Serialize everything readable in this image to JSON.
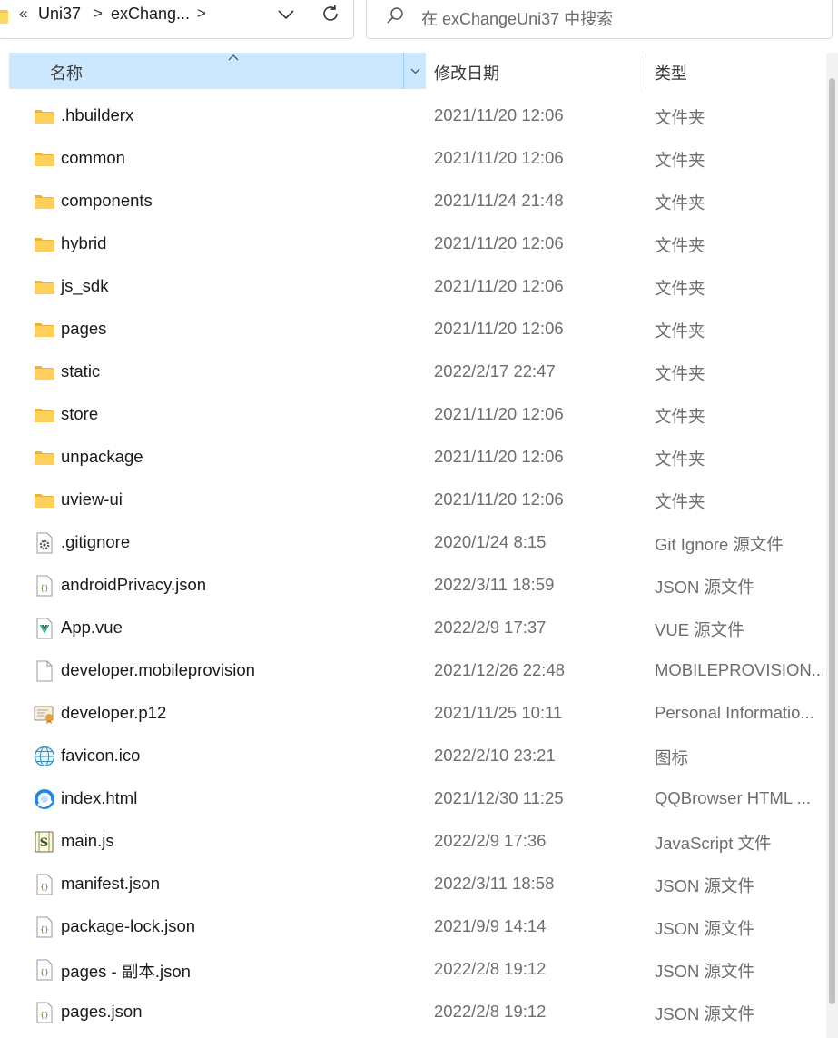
{
  "address_bar": {
    "overflow_glyph": "«",
    "crumbs": [
      "Uni37",
      "exChang..."
    ],
    "separator": ">"
  },
  "search": {
    "placeholder": "在 exChangeUni37 中搜索"
  },
  "columns": {
    "name": "名称",
    "date": "修改日期",
    "type": "类型"
  },
  "files": [
    {
      "name": ".hbuilderx",
      "date": "2021/11/20 12:06",
      "type": "文件夹",
      "icon": "folder-icon"
    },
    {
      "name": "common",
      "date": "2021/11/20 12:06",
      "type": "文件夹",
      "icon": "folder-icon"
    },
    {
      "name": "components",
      "date": "2021/11/24 21:48",
      "type": "文件夹",
      "icon": "folder-icon"
    },
    {
      "name": "hybrid",
      "date": "2021/11/20 12:06",
      "type": "文件夹",
      "icon": "folder-icon"
    },
    {
      "name": "js_sdk",
      "date": "2021/11/20 12:06",
      "type": "文件夹",
      "icon": "folder-icon"
    },
    {
      "name": "pages",
      "date": "2021/11/20 12:06",
      "type": "文件夹",
      "icon": "folder-icon"
    },
    {
      "name": "static",
      "date": "2022/2/17 22:47",
      "type": "文件夹",
      "icon": "folder-icon"
    },
    {
      "name": "store",
      "date": "2021/11/20 12:06",
      "type": "文件夹",
      "icon": "folder-icon"
    },
    {
      "name": "unpackage",
      "date": "2021/11/20 12:06",
      "type": "文件夹",
      "icon": "folder-icon"
    },
    {
      "name": "uview-ui",
      "date": "2021/11/20 12:06",
      "type": "文件夹",
      "icon": "folder-icon"
    },
    {
      "name": ".gitignore",
      "date": "2020/1/24 8:15",
      "type": "Git Ignore 源文件",
      "icon": "gear-file-icon"
    },
    {
      "name": "androidPrivacy.json",
      "date": "2022/3/11 18:59",
      "type": "JSON 源文件",
      "icon": "json-file-icon"
    },
    {
      "name": "App.vue",
      "date": "2022/2/9 17:37",
      "type": "VUE 源文件",
      "icon": "vue-file-icon"
    },
    {
      "name": "developer.mobileprovision",
      "date": "2021/12/26 22:48",
      "type": "MOBILEPROVISION...",
      "icon": "blank-file-icon"
    },
    {
      "name": "developer.p12",
      "date": "2021/11/25 10:11",
      "type": "Personal Informatio...",
      "icon": "certificate-file-icon"
    },
    {
      "name": "favicon.ico",
      "date": "2022/2/10 23:21",
      "type": "图标",
      "icon": "globe-file-icon"
    },
    {
      "name": "index.html",
      "date": "2021/12/30 11:25",
      "type": "QQBrowser HTML ...",
      "icon": "qqbrowser-file-icon"
    },
    {
      "name": "main.js",
      "date": "2022/2/9 17:36",
      "type": "JavaScript 文件",
      "icon": "script-file-icon"
    },
    {
      "name": "manifest.json",
      "date": "2022/3/11 18:58",
      "type": "JSON 源文件",
      "icon": "json-file-icon"
    },
    {
      "name": "package-lock.json",
      "date": "2021/9/9 14:14",
      "type": "JSON 源文件",
      "icon": "json-file-icon"
    },
    {
      "name": "pages - 副本.json",
      "date": "2022/2/8 19:12",
      "type": "JSON 源文件",
      "icon": "json-file-icon"
    },
    {
      "name": "pages.json",
      "date": "2022/2/8 19:12",
      "type": "JSON 源文件",
      "icon": "json-file-icon"
    }
  ],
  "colors": {
    "header_selected": "#cce8ff",
    "folder": "#f8c64a",
    "text_secondary": "#6d6d6d"
  }
}
